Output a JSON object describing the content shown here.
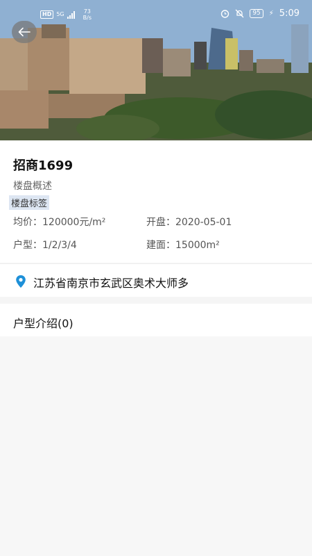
{
  "status_bar": {
    "network_badge": "HD",
    "network_type": "5G",
    "speed_value": "73",
    "speed_unit": "B/s",
    "battery": "95",
    "time": "5:09"
  },
  "hero": {
    "image_alt": "city-skyline-photo"
  },
  "property": {
    "name": "招商1699",
    "overview_label": "楼盘概述",
    "tag_label": "楼盘标签",
    "avg_price_label": "均价：",
    "avg_price_value": "120000元/m²",
    "opening_label": "开盘：",
    "opening_value": "2020-05-01",
    "layout_label": "户型：",
    "layout_value": "1/2/3/4",
    "area_label": "建面：",
    "area_value": "15000m²"
  },
  "address": {
    "text": "江苏省南京市玄武区奥术大师多"
  },
  "sections": {
    "layout_intro": "户型介绍(0)"
  },
  "colors": {
    "accent": "#1e90d8",
    "tag_bg": "#dde6f2"
  }
}
